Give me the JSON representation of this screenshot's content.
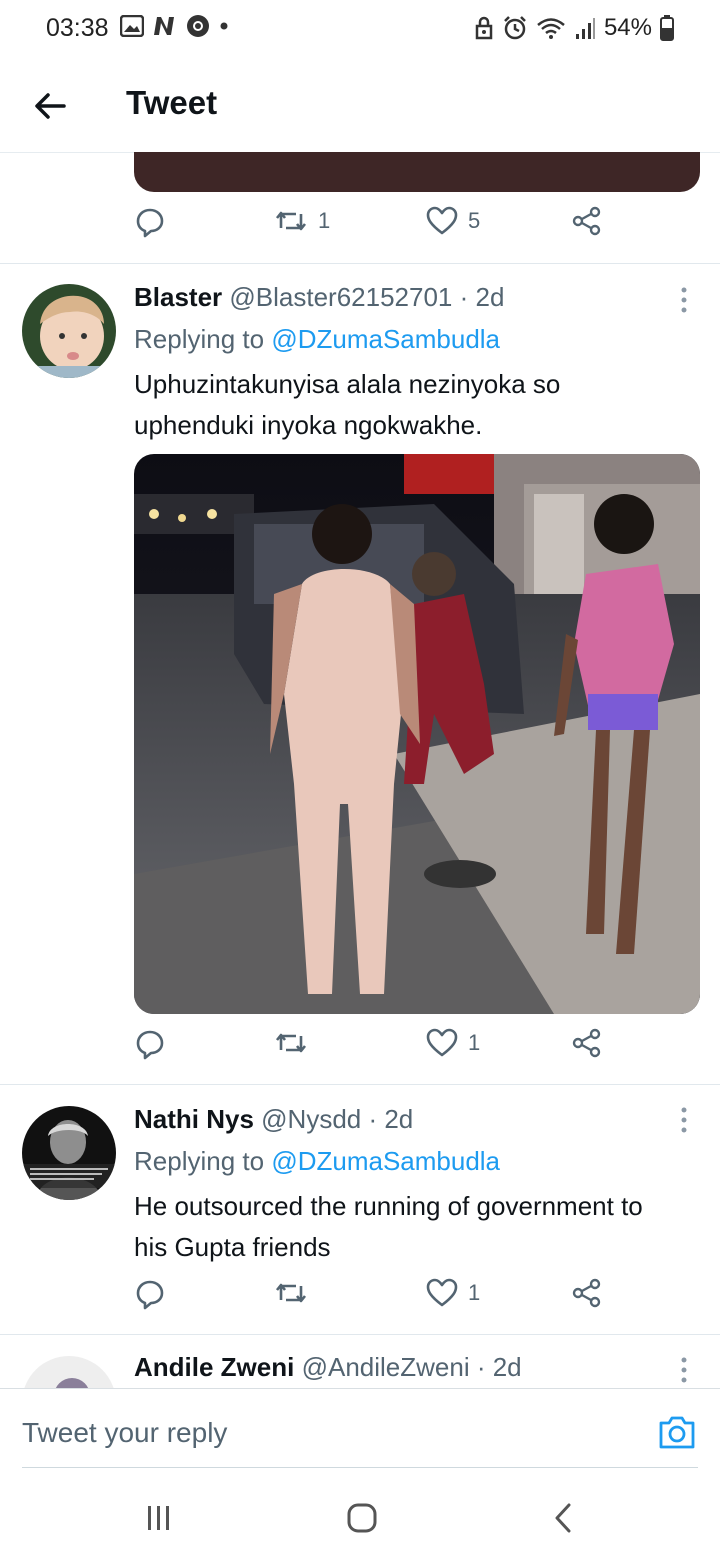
{
  "status": {
    "time": "03:38",
    "battery": "54%",
    "icons": [
      "gallery-icon",
      "n-icon",
      "chrome-icon",
      "dot-icon",
      "alarm-lock-icon",
      "alarm-icon",
      "wifi-icon",
      "signal-icon",
      "battery-icon"
    ]
  },
  "header": {
    "title": "Tweet"
  },
  "top_actions": {
    "retweets": "1",
    "likes": "5"
  },
  "tweets": [
    {
      "name": "Blaster",
      "handle": "@Blaster62152701 · 2d",
      "replying_label": "Replying to",
      "mention": "@DZumaSambudla",
      "text": "Uphuzintakunyisa alala nezinyoka so uphenduki inyoka ngokwakhe.",
      "likes": "1"
    },
    {
      "name": "Nathi Nys",
      "handle": "@Nysdd · 2d",
      "replying_label": "Replying to",
      "mention": "@DZumaSambudla",
      "text": "He outsourced the running of government to his Gupta friends",
      "likes": "1"
    },
    {
      "name": "Andile Zweni",
      "handle": "@AndileZweni · 2d"
    }
  ],
  "reply_bar": {
    "placeholder": "Tweet your reply"
  },
  "colors": {
    "accent": "#1d9bf0",
    "secondary_text": "#536471",
    "primary_text": "#0f1419"
  }
}
